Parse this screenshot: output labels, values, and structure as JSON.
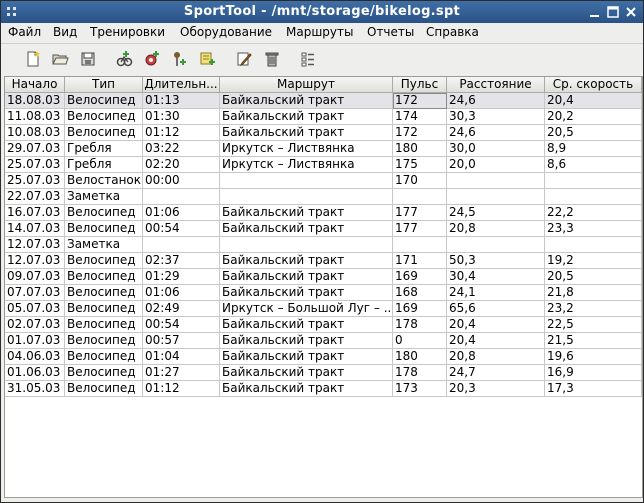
{
  "window": {
    "title": "SportTool - /mnt/storage/bikelog.spt"
  },
  "menu": [
    "Файл",
    "Вид",
    "Тренировки",
    "Оборудование",
    "Маршруты",
    "Отчеты",
    "Справка"
  ],
  "toolbar_icons": [
    "new-document-icon",
    "open-folder-icon",
    "save-icon",
    "add-exercise-icon",
    "add-equipment-icon",
    "add-route-icon",
    "add-note-icon",
    "edit-icon",
    "delete-icon",
    "view-options-icon"
  ],
  "table": {
    "columns": [
      "Начало",
      "Тип",
      "Длительн...",
      "Маршрут",
      "Пульс",
      "Расстояние",
      "Ср. скорость"
    ],
    "rows": [
      [
        "18.08.03",
        "Велосипед",
        "01:13",
        "Байкальский тракт",
        "172",
        "24,6",
        "20,4"
      ],
      [
        "11.08.03",
        "Велосипед",
        "01:30",
        "Байкальский тракт",
        "174",
        "30,3",
        "20,2"
      ],
      [
        "10.08.03",
        "Велосипед",
        "01:12",
        "Байкальский тракт",
        "172",
        "24,6",
        "20,5"
      ],
      [
        "29.07.03",
        "Гребля",
        "03:22",
        "Иркутск – Листвянка",
        "180",
        "30,0",
        "8,9"
      ],
      [
        "25.07.03",
        "Гребля",
        "02:20",
        "Иркутск – Листвянка",
        "175",
        "20,0",
        "8,6"
      ],
      [
        "25.07.03",
        "Велостанок",
        "00:00",
        "",
        "170",
        "",
        ""
      ],
      [
        "22.07.03",
        "Заметка",
        "",
        "",
        "",
        "",
        ""
      ],
      [
        "16.07.03",
        "Велосипед",
        "01:06",
        "Байкальский тракт",
        "177",
        "24,5",
        "22,2"
      ],
      [
        "14.07.03",
        "Велосипед",
        "00:54",
        "Байкальский тракт",
        "177",
        "20,8",
        "23,3"
      ],
      [
        "12.07.03",
        "Заметка",
        "",
        "",
        "",
        "",
        ""
      ],
      [
        "12.07.03",
        "Велосипед",
        "02:37",
        "Байкальский тракт",
        "171",
        "50,3",
        "19,2"
      ],
      [
        "09.07.03",
        "Велосипед",
        "01:29",
        "Байкальский тракт",
        "169",
        "30,4",
        "20,5"
      ],
      [
        "07.07.03",
        "Велосипед",
        "01:06",
        "Байкальский тракт",
        "168",
        "24,1",
        "21,8"
      ],
      [
        "05.07.03",
        "Велосипед",
        "02:49",
        "Иркутск – Большой Луг – ...",
        "169",
        "65,6",
        "23,2"
      ],
      [
        "02.07.03",
        "Велосипед",
        "00:54",
        "Байкальский тракт",
        "178",
        "20,4",
        "22,5"
      ],
      [
        "01.07.03",
        "Велосипед",
        "00:57",
        "Байкальский тракт",
        "0",
        "20,4",
        "21,5"
      ],
      [
        "04.06.03",
        "Велосипед",
        "01:04",
        "Байкальский тракт",
        "180",
        "20,8",
        "19,6"
      ],
      [
        "01.06.03",
        "Велосипед",
        "01:27",
        "Байкальский тракт",
        "178",
        "24,7",
        "16,9"
      ],
      [
        "31.05.03",
        "Велосипед",
        "01:12",
        "Байкальский тракт",
        "173",
        "20,3",
        "17,3"
      ]
    ]
  }
}
